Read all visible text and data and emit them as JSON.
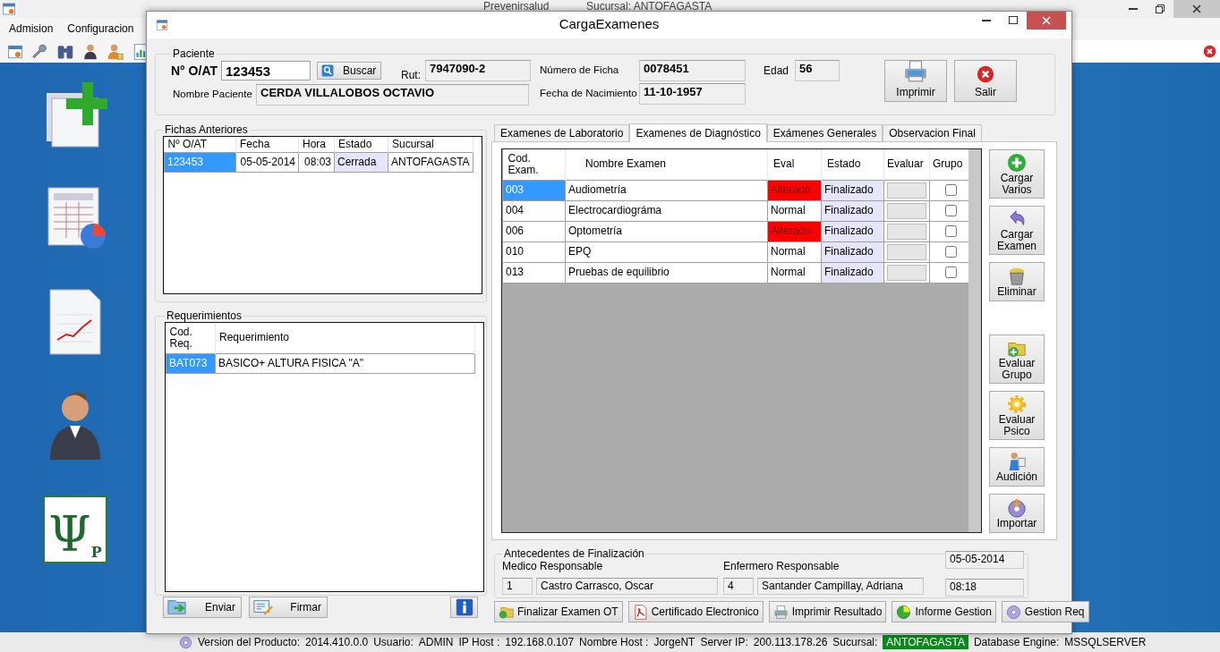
{
  "app": {
    "title": "Prevenirsalud",
    "subtitle": "Sucursal: ANTOFAGASTA",
    "menu": [
      "Admision",
      "Configuracion"
    ],
    "toolbar": [
      {
        "kind": "table"
      },
      {
        "kind": "wrench"
      },
      {
        "kind": "binoculars"
      },
      {
        "kind": "person"
      },
      {
        "kind": "person-lock"
      },
      {
        "kind": "chart-doc"
      }
    ],
    "desktop_icons": [
      {
        "kind": "new-docs"
      },
      {
        "kind": "spreadsheet"
      },
      {
        "kind": "report"
      },
      {
        "kind": "person"
      },
      {
        "kind": "psi",
        "glyph": "Ψ",
        "letter": "P"
      }
    ]
  },
  "dialog": {
    "title": "CargaExamenes"
  },
  "paciente": {
    "legend": "Paciente",
    "oat_label": "N° O/AT",
    "oat_value": "123453",
    "search_button": "Buscar",
    "rut_label": "Rut:",
    "rut": "7947090-2",
    "nombre_label": "Nombre Paciente",
    "nombre": "CERDA VILLALOBOS OCTAVIO",
    "ficha_label": "Número de Ficha",
    "ficha": "0078451",
    "nacimiento_label": "Fecha de Nacimiento",
    "nacimiento": "11-10-1957",
    "edad_label": "Edad",
    "edad": "56"
  },
  "top_buttons": [
    {
      "label": "Imprimir",
      "kind": "printer"
    },
    {
      "label": "Salir",
      "kind": "exit"
    }
  ],
  "fichas": {
    "legend": "Fichas Anteriores",
    "columns": [
      "Nº O/AT",
      "Fecha",
      "Hora",
      "Estado",
      "Sucursal"
    ],
    "rows": [
      {
        "cells": [
          "123453",
          "05-05-2014",
          "08:03",
          "Cerrada",
          "ANTOFAGASTA"
        ],
        "selected": true
      }
    ]
  },
  "requerimientos": {
    "legend": "Requerimientos",
    "columns": [
      "Cod. Req.",
      "Requerimiento"
    ],
    "rows": [
      {
        "cells": [
          "BAT073",
          "BASICO+ ALTURA FISICA \"A\""
        ],
        "selected": true
      }
    ]
  },
  "left_buttons": [
    {
      "label": "Enviar",
      "kind": "send"
    },
    {
      "label": "Firmar",
      "kind": "sign"
    },
    {
      "kind": "info"
    }
  ],
  "tabs": [
    {
      "label": "Examenes de Laboratorio",
      "selected": false
    },
    {
      "label": "Examenes de Diagnóstico",
      "selected": true
    },
    {
      "label": "Exámenes Generales",
      "selected": false
    },
    {
      "label": "Observacion Final",
      "selected": false
    }
  ],
  "exams": {
    "columns": [
      "Cod. Exam.",
      "Nombre Examen",
      "Eval",
      "Estado",
      "Evaluar",
      "Grupo"
    ],
    "rows": [
      {
        "code": "003",
        "name": "Audiometría",
        "eval": "Alterado",
        "altered": true,
        "estado": "Finalizado",
        "grupo": false,
        "selected": true
      },
      {
        "code": "004",
        "name": "Electrocardiográma",
        "eval": "Normal",
        "altered": false,
        "estado": "Finalizado",
        "grupo": false,
        "selected": false
      },
      {
        "code": "006",
        "name": "Optometría",
        "eval": "Alterado",
        "altered": true,
        "estado": "Finalizado",
        "grupo": false,
        "selected": false
      },
      {
        "code": "010",
        "name": "EPQ",
        "eval": "Normal",
        "altered": false,
        "estado": "Finalizado",
        "grupo": false,
        "selected": false
      },
      {
        "code": "013",
        "name": "Pruebas de equilibrio",
        "eval": "Normal",
        "altered": false,
        "estado": "Finalizado",
        "grupo": false,
        "selected": false
      }
    ]
  },
  "side_buttons": [
    {
      "label": "Cargar Varios",
      "kind": "add"
    },
    {
      "label": "Cargar Examen",
      "kind": "undo"
    },
    {
      "label": "Eliminar",
      "kind": "trash"
    },
    {
      "label": "Evaluar Grupo",
      "kind": "group"
    },
    {
      "label": "Evaluar Psico",
      "kind": "gear"
    },
    {
      "label": "Audición",
      "kind": "figure"
    },
    {
      "label": "Importar",
      "kind": "import"
    }
  ],
  "antecedentes": {
    "legend": "Antecedentes de Finalización",
    "medico_label": "Medico Responsable",
    "medico_id": "1",
    "medico_name": "Castro Carrasco, Oscar",
    "enfermero_label": "Enfermero Responsable",
    "enfermero_id": "4",
    "enfermero_name": "Santander Campillay, Adriana",
    "date": "05-05-2014",
    "time": "08:18"
  },
  "bottom_buttons": [
    {
      "label": "Finalizar Examen OT",
      "kind": "finalize"
    },
    {
      "label": "Certificado Electronico",
      "kind": "pdf"
    },
    {
      "label": "Imprimir Resultado",
      "kind": "print-result"
    },
    {
      "label": "Informe Gestion",
      "kind": "report"
    },
    {
      "label": "Gestion Req",
      "kind": "disc"
    }
  ],
  "status_bar": [
    {
      "label": "Version del Producto:",
      "value": "2014.410.0.0",
      "highlight": false
    },
    {
      "label": "Usuario:",
      "value": "ADMIN",
      "highlight": false
    },
    {
      "label": "IP Host :",
      "value": "192.168.0.107",
      "highlight": false
    },
    {
      "label": "Nombre Host :",
      "value": "JorgeNT",
      "highlight": false
    },
    {
      "label": "Server IP:",
      "value": "200.113.178.26",
      "highlight": false
    },
    {
      "label": "Sucursal:",
      "value": "ANTOFAGASTA",
      "highlight": true
    },
    {
      "label": "Database Engine:",
      "value": "MSSQLSERVER",
      "highlight": false
    }
  ]
}
